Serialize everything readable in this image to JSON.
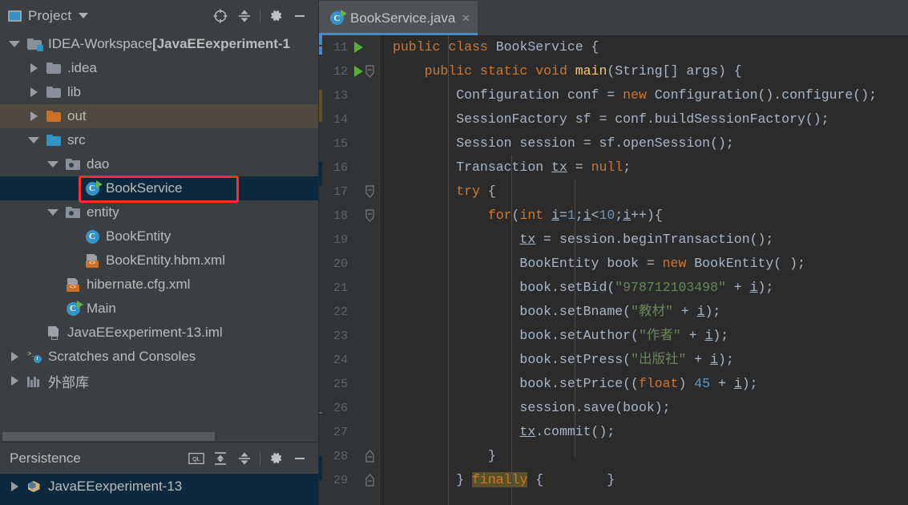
{
  "project_panel": {
    "title": "Project",
    "icons": {
      "project": "project-window-icon",
      "dropdown": "chevron-down-icon",
      "locate": "locate-target-icon",
      "collapse_all": "collapse-all-icon",
      "settings": "gear-icon",
      "hide": "minimize-icon"
    },
    "tree": [
      {
        "label": "IDEA-Workspace ",
        "bold": "[JavaEEexperiment-1",
        "icon": "module-folder-icon",
        "arrow": "expanded",
        "depth": 0,
        "type": "root"
      },
      {
        "label": ".idea",
        "icon": "folder-icon",
        "arrow": "collapsed",
        "depth": 1,
        "type": "folder"
      },
      {
        "label": "lib",
        "icon": "folder-icon",
        "arrow": "collapsed",
        "depth": 1,
        "type": "folder"
      },
      {
        "label": "out",
        "icon": "folder-orange-icon",
        "arrow": "collapsed",
        "depth": 1,
        "type": "folder-excluded",
        "highlight": "out"
      },
      {
        "label": "src",
        "icon": "folder-source-icon",
        "arrow": "expanded",
        "depth": 1,
        "type": "folder-source"
      },
      {
        "label": "dao",
        "icon": "package-icon",
        "arrow": "expanded",
        "depth": 2,
        "type": "package"
      },
      {
        "label": "BookService",
        "icon": "java-class-runnable-icon",
        "arrow": "none",
        "depth": 3,
        "type": "class",
        "selected": true,
        "outlined": true
      },
      {
        "label": "entity",
        "icon": "package-icon",
        "arrow": "expanded",
        "depth": 2,
        "type": "package"
      },
      {
        "label": "BookEntity",
        "icon": "java-class-icon",
        "arrow": "none",
        "depth": 3,
        "type": "class"
      },
      {
        "label": "BookEntity.hbm.xml",
        "icon": "xml-file-icon",
        "arrow": "none",
        "depth": 3,
        "type": "xml"
      },
      {
        "label": "hibernate.cfg.xml",
        "icon": "xml-file-icon",
        "arrow": "none",
        "depth": 2,
        "type": "xml"
      },
      {
        "label": "Main",
        "icon": "java-class-runnable-icon",
        "arrow": "none",
        "depth": 2,
        "type": "class"
      },
      {
        "label": "JavaEEexperiment-13.iml",
        "icon": "iml-file-icon",
        "arrow": "none",
        "depth": 1,
        "type": "iml"
      },
      {
        "label": "Scratches and Consoles",
        "icon": "scratches-icon",
        "arrow": "collapsed",
        "depth": 0,
        "type": "scratches"
      },
      {
        "label": "外部库",
        "icon": "external-libraries-icon",
        "arrow": "collapsed",
        "depth": 0,
        "type": "libraries"
      }
    ]
  },
  "persistence_panel": {
    "title": "Persistence",
    "icons": {
      "console": "ql-console-icon",
      "expand_all": "expand-all-icon",
      "collapse_all": "collapse-all-icon",
      "settings": "gear-icon",
      "hide": "minimize-icon"
    },
    "rows": [
      {
        "label": "JavaEEexperiment-13",
        "icon": "persistence-unit-icon",
        "arrow": "collapsed",
        "selected": true
      }
    ]
  },
  "editor": {
    "tab": {
      "label": "BookService.java",
      "icon": "java-class-runnable-icon",
      "close": "×"
    },
    "first_line_number": 11,
    "lines": [
      {
        "n": 11,
        "run": true,
        "fold": false,
        "tokens": [
          {
            "t": "public ",
            "c": "kw"
          },
          {
            "t": "class ",
            "c": "kw"
          },
          {
            "t": "BookService",
            "c": "txt"
          },
          {
            "t": " {",
            "c": "txt"
          }
        ],
        "indent": 0
      },
      {
        "n": 12,
        "run": true,
        "fold": true,
        "tokens": [
          {
            "t": "    ",
            "c": "txt"
          },
          {
            "t": "public ",
            "c": "kw"
          },
          {
            "t": "static ",
            "c": "kw"
          },
          {
            "t": "void ",
            "c": "kw"
          },
          {
            "t": "main",
            "c": "fn"
          },
          {
            "t": "(String[] args) {",
            "c": "txt"
          }
        ],
        "indent": 0
      },
      {
        "n": 13,
        "run": false,
        "fold": false,
        "tokens": [
          {
            "t": "        Configuration conf = ",
            "c": "txt"
          },
          {
            "t": "new ",
            "c": "kw"
          },
          {
            "t": "Configuration().configure();",
            "c": "txt"
          }
        ],
        "indent": 1
      },
      {
        "n": 14,
        "run": false,
        "fold": false,
        "tokens": [
          {
            "t": "        SessionFactory sf = conf.buildSessionFactory();",
            "c": "txt"
          }
        ],
        "indent": 1
      },
      {
        "n": 15,
        "run": false,
        "fold": false,
        "tokens": [
          {
            "t": "        Session session = sf.openSession();",
            "c": "txt"
          }
        ],
        "indent": 1
      },
      {
        "n": 16,
        "run": false,
        "fold": false,
        "tokens": [
          {
            "t": "        Transaction ",
            "c": "txt"
          },
          {
            "t": "tx",
            "c": "fld"
          },
          {
            "t": " = ",
            "c": "txt"
          },
          {
            "t": "null",
            "c": "kw"
          },
          {
            "t": ";",
            "c": "txt"
          }
        ],
        "indent": 1
      },
      {
        "n": 17,
        "run": false,
        "fold": true,
        "tokens": [
          {
            "t": "        ",
            "c": "txt"
          },
          {
            "t": "try",
            "c": "kw"
          },
          {
            "t": " {",
            "c": "txt"
          }
        ],
        "indent": 1
      },
      {
        "n": 18,
        "run": false,
        "fold": true,
        "tokens": [
          {
            "t": "            ",
            "c": "txt"
          },
          {
            "t": "for",
            "c": "kw"
          },
          {
            "t": "(",
            "c": "txt"
          },
          {
            "t": "int ",
            "c": "kw"
          },
          {
            "t": "i",
            "c": "fld"
          },
          {
            "t": "=",
            "c": "txt"
          },
          {
            "t": "1",
            "c": "num"
          },
          {
            "t": ";",
            "c": "txt"
          },
          {
            "t": "i",
            "c": "fld"
          },
          {
            "t": "<",
            "c": "txt"
          },
          {
            "t": "10",
            "c": "num"
          },
          {
            "t": ";",
            "c": "txt"
          },
          {
            "t": "i",
            "c": "fld"
          },
          {
            "t": "++){",
            "c": "txt"
          }
        ],
        "indent": 2
      },
      {
        "n": 19,
        "run": false,
        "fold": false,
        "tokens": [
          {
            "t": "                ",
            "c": "txt"
          },
          {
            "t": "tx",
            "c": "fld"
          },
          {
            "t": " = session.beginTransaction();",
            "c": "txt"
          }
        ],
        "indent": 3
      },
      {
        "n": 20,
        "run": false,
        "fold": false,
        "tokens": [
          {
            "t": "                BookEntity book = ",
            "c": "txt"
          },
          {
            "t": "new ",
            "c": "kw"
          },
          {
            "t": "BookEntity( );",
            "c": "txt"
          }
        ],
        "indent": 3
      },
      {
        "n": 21,
        "run": false,
        "fold": false,
        "tokens": [
          {
            "t": "                book.setBid(",
            "c": "txt"
          },
          {
            "t": "\"978712103498\"",
            "c": "str"
          },
          {
            "t": " + ",
            "c": "txt"
          },
          {
            "t": "i",
            "c": "fld"
          },
          {
            "t": ");",
            "c": "txt"
          }
        ],
        "indent": 3
      },
      {
        "n": 22,
        "run": false,
        "fold": false,
        "tokens": [
          {
            "t": "                book.setBname(",
            "c": "txt"
          },
          {
            "t": "\"教材\"",
            "c": "str"
          },
          {
            "t": " + ",
            "c": "txt"
          },
          {
            "t": "i",
            "c": "fld"
          },
          {
            "t": ");",
            "c": "txt"
          }
        ],
        "indent": 3
      },
      {
        "n": 23,
        "run": false,
        "fold": false,
        "tokens": [
          {
            "t": "                book.setAuthor(",
            "c": "txt"
          },
          {
            "t": "\"作者\"",
            "c": "str"
          },
          {
            "t": " + ",
            "c": "txt"
          },
          {
            "t": "i",
            "c": "fld"
          },
          {
            "t": ");",
            "c": "txt"
          }
        ],
        "indent": 3
      },
      {
        "n": 24,
        "run": false,
        "fold": false,
        "tokens": [
          {
            "t": "                book.setPress(",
            "c": "txt"
          },
          {
            "t": "\"出版社\"",
            "c": "str"
          },
          {
            "t": " + ",
            "c": "txt"
          },
          {
            "t": "i",
            "c": "fld"
          },
          {
            "t": ");",
            "c": "txt"
          }
        ],
        "indent": 3
      },
      {
        "n": 25,
        "run": false,
        "fold": false,
        "tokens": [
          {
            "t": "                book.setPrice((",
            "c": "txt"
          },
          {
            "t": "float",
            "c": "kw"
          },
          {
            "t": ") ",
            "c": "txt"
          },
          {
            "t": "45",
            "c": "num"
          },
          {
            "t": " + ",
            "c": "txt"
          },
          {
            "t": "i",
            "c": "fld"
          },
          {
            "t": ");",
            "c": "txt"
          }
        ],
        "indent": 3
      },
      {
        "n": 26,
        "run": false,
        "fold": false,
        "tokens": [
          {
            "t": "                session.save(book);",
            "c": "txt"
          }
        ],
        "indent": 3
      },
      {
        "n": 27,
        "run": false,
        "fold": false,
        "tokens": [
          {
            "t": "                ",
            "c": "txt"
          },
          {
            "t": "tx",
            "c": "fld"
          },
          {
            "t": ".commit();",
            "c": "txt"
          }
        ],
        "indent": 3
      },
      {
        "n": 28,
        "run": false,
        "fold": "end",
        "tokens": [
          {
            "t": "            }",
            "c": "txt"
          }
        ],
        "indent": 2
      },
      {
        "n": 29,
        "run": false,
        "fold": "end",
        "tokens": [
          {
            "t": "        } ",
            "c": "txt"
          },
          {
            "t": "finally",
            "c": "sel-kw"
          },
          {
            "t": " {        }",
            "c": "txt"
          }
        ],
        "indent": 1
      }
    ]
  },
  "colors": {
    "panel_bg": "#3c3f41",
    "editor_bg": "#2b2b2b",
    "gutter_bg": "#313335",
    "selection_blue": "#0d293e",
    "tab_underline": "#4a88c7",
    "highlight_red": "#ff2d2d",
    "excluded_row": "#4e4a3f",
    "keyword": "#cc7832",
    "string": "#6a8759",
    "number": "#6897bb",
    "method": "#ffc66d",
    "text": "#a9b7c6"
  }
}
